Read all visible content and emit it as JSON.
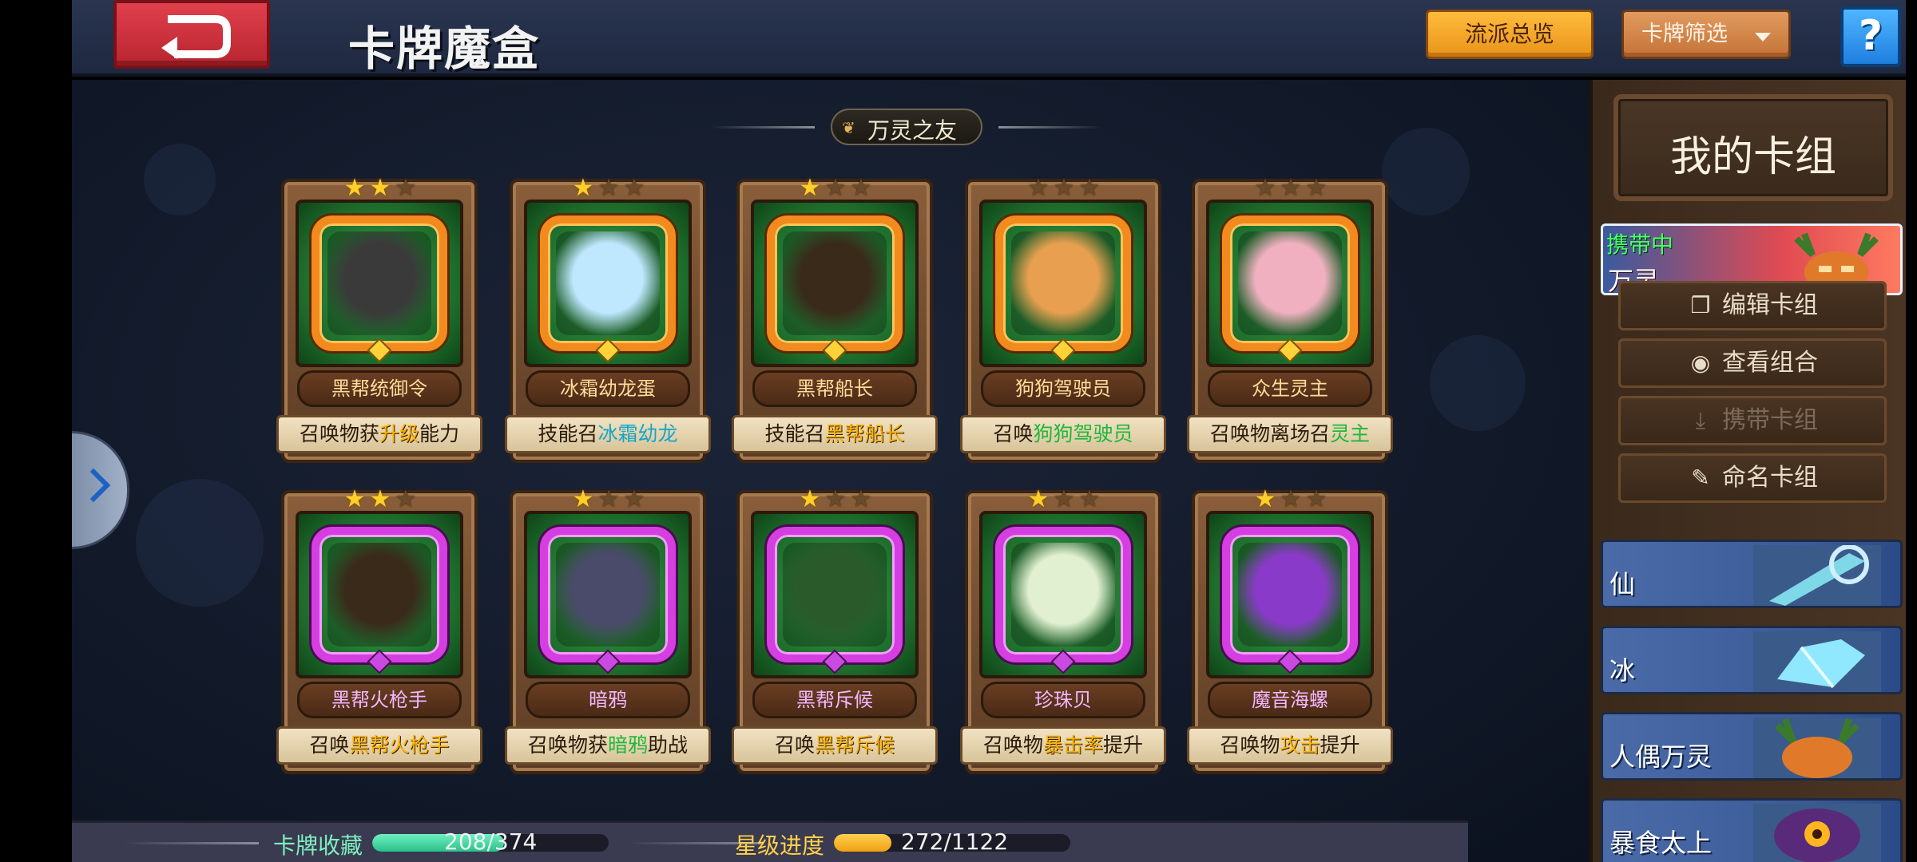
{
  "header": {
    "title": "卡牌魔盒",
    "overview_label": "流派总览",
    "filter_label": "卡牌筛选",
    "help_label": "?"
  },
  "section": {
    "title": "万灵之友"
  },
  "cards": [
    {
      "name": "黑帮统御令",
      "stars": 2,
      "rarity": "orange",
      "desc_pre": "召唤物获",
      "desc_hl": "升级",
      "desc_post": "能力",
      "hl_color": "gold"
    },
    {
      "name": "冰霜幼龙蛋",
      "stars": 1,
      "rarity": "orange",
      "desc_pre": "技能召",
      "desc_hl": "冰霜幼龙",
      "desc_post": "",
      "hl_color": "teal"
    },
    {
      "name": "黑帮船长",
      "stars": 1,
      "rarity": "orange",
      "desc_pre": "技能召",
      "desc_hl": "黑帮船长",
      "desc_post": "",
      "hl_color": "gold"
    },
    {
      "name": "狗狗驾驶员",
      "stars": 0,
      "rarity": "orange",
      "desc_pre": "召唤",
      "desc_hl": "狗狗驾驶员",
      "desc_post": "",
      "hl_color": "green"
    },
    {
      "name": "众生灵主",
      "stars": 0,
      "rarity": "orange",
      "desc_pre": "召唤物离场召",
      "desc_hl": "灵主",
      "desc_post": "",
      "hl_color": "green"
    },
    {
      "name": "黑帮火枪手",
      "stars": 2,
      "rarity": "purple",
      "desc_pre": "召唤",
      "desc_hl": "黑帮火枪手",
      "desc_post": "",
      "hl_color": "gold"
    },
    {
      "name": "暗鸦",
      "stars": 1,
      "rarity": "purple",
      "desc_pre": "召唤物获",
      "desc_hl": "暗鸦",
      "desc_post": "助战",
      "hl_color": "green"
    },
    {
      "name": "黑帮斥候",
      "stars": 1,
      "rarity": "purple",
      "desc_pre": "召唤",
      "desc_hl": "黑帮斥候",
      "desc_post": "",
      "hl_color": "gold"
    },
    {
      "name": "珍珠贝",
      "stars": 1,
      "rarity": "purple",
      "desc_pre": "召唤物",
      "desc_hl": "暴击率",
      "desc_post": "提升",
      "hl_color": "gold"
    },
    {
      "name": "魔音海螺",
      "stars": 1,
      "rarity": "purple",
      "desc_pre": "召唤物",
      "desc_hl": "攻击",
      "desc_post": "提升",
      "hl_color": "gold"
    }
  ],
  "bottom": {
    "collection_label": "卡牌收藏",
    "collection_value": "208/374",
    "collection_fraction": 0.556,
    "star_label": "星级进度",
    "star_value": "272/1122",
    "star_fraction": 0.242
  },
  "panel": {
    "title": "我的卡组",
    "carrying_tag": "携带中",
    "carrying_name": "万灵",
    "buttons": [
      {
        "label": "编辑卡组",
        "icon": "copy-icon",
        "enabled": true
      },
      {
        "label": "查看组合",
        "icon": "eye-icon",
        "enabled": true
      },
      {
        "label": "携带卡组",
        "icon": "download-icon",
        "enabled": false
      },
      {
        "label": "命名卡组",
        "icon": "pencil-icon",
        "enabled": true
      }
    ],
    "decks": [
      {
        "label": "仙"
      },
      {
        "label": "冰"
      },
      {
        "label": "人偶万灵"
      },
      {
        "label": "暴食太上"
      }
    ]
  },
  "colors": {
    "accent_orange": "#f28a1e",
    "accent_purple": "#d53ee0",
    "collection_bar": "#3ce0a0",
    "star_bar": "#ffb420"
  }
}
